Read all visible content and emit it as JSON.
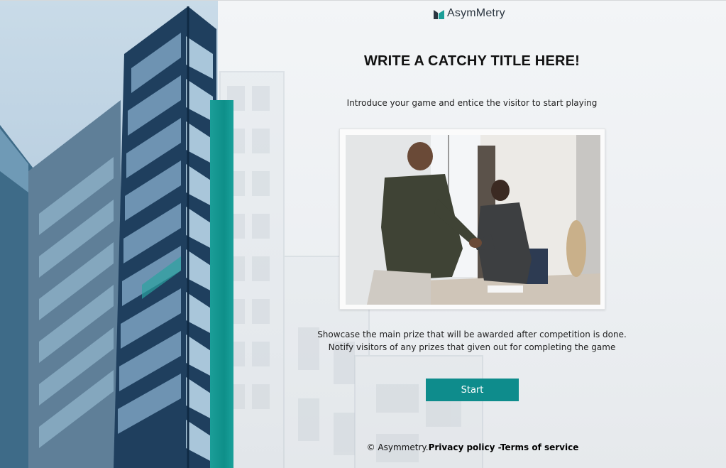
{
  "brand": {
    "logo_icon": "asymmetry-logo-icon",
    "name": "AsymMetry",
    "accent_color": "#0e8c8c"
  },
  "main": {
    "title": "WRITE A CATCHY TITLE HERE!",
    "intro": "Introduce your game and entice the visitor to start playing",
    "prize_line_1": "Showcase the main prize that will be awarded after competition is done.",
    "prize_line_2": "Notify visitors of any prizes that given out for completing the game",
    "start_label": "Start"
  },
  "footer": {
    "copyright": "© Asymmetry.",
    "privacy_label": "Privacy policy",
    "separator": " -",
    "terms_label": "Terms of service"
  },
  "images": {
    "left": "building-photo",
    "card": "business-handshake-photo"
  }
}
